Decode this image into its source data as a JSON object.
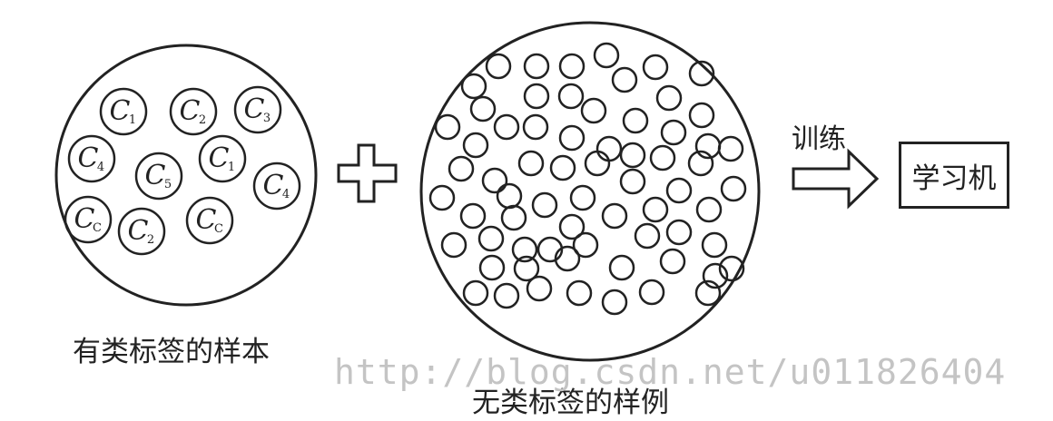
{
  "labeled_set": {
    "caption": "有类标签的样本",
    "samples": [
      {
        "letter": "C",
        "sub": "1"
      },
      {
        "letter": "C",
        "sub": "2"
      },
      {
        "letter": "C",
        "sub": "3"
      },
      {
        "letter": "C",
        "sub": "4"
      },
      {
        "letter": "C",
        "sub": "5"
      },
      {
        "letter": "C",
        "sub": "1"
      },
      {
        "letter": "C",
        "sub": "4"
      },
      {
        "letter": "C",
        "sub": "C"
      },
      {
        "letter": "C",
        "sub": "2"
      },
      {
        "letter": "C",
        "sub": "C"
      }
    ]
  },
  "unlabeled_set": {
    "caption": "无类标签的样例"
  },
  "arrow": {
    "label": "训练"
  },
  "learner": {
    "label": "学习机"
  },
  "watermark": "http://blog.csdn.net/u011826404",
  "colors": {
    "stroke": "#222222",
    "watermark": "#c4c4c4",
    "background": "#ffffff"
  }
}
